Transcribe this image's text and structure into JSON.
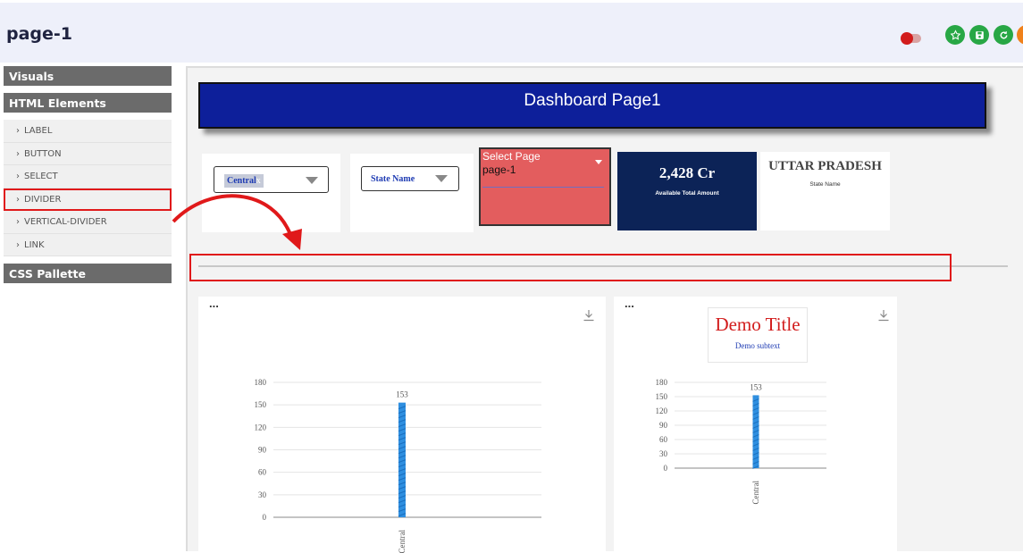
{
  "header": {
    "title": "page-1",
    "buttons": [
      {
        "name": "star",
        "color": "#28a745"
      },
      {
        "name": "save",
        "color": "#28a745"
      },
      {
        "name": "refresh",
        "color": "#28a745"
      },
      {
        "name": "extra",
        "color": "#f0811a"
      }
    ]
  },
  "sidebar": {
    "visuals": "Visuals",
    "html_elements": "HTML Elements",
    "items": [
      {
        "label": "LABEL"
      },
      {
        "label": "BUTTON"
      },
      {
        "label": "SELECT"
      },
      {
        "label": "DIVIDER",
        "highlighted": true
      },
      {
        "label": "VERTICAL-DIVIDER"
      },
      {
        "label": "LINK"
      }
    ],
    "css_palette": "CSS Pallette"
  },
  "dashboard": {
    "banner": "Dashboard Page1",
    "filter_central": {
      "chip": "Central",
      "chip_remove": "x"
    },
    "filter_state": {
      "placeholder": "State Name"
    },
    "page_select": {
      "label": "Select Page",
      "value": "page-1"
    },
    "kpi": {
      "value": "2,428 Cr",
      "label": "Available Total Amount"
    },
    "state_card": {
      "value": "UTTAR PRADESH",
      "label": "State Name"
    },
    "chart_menu": "...",
    "demo": {
      "title": "Demo Title",
      "subtitle": "Demo subtext"
    }
  },
  "chart_data": [
    {
      "type": "bar",
      "categories": [
        "Central"
      ],
      "values": [
        153
      ],
      "data_labels": [
        "153"
      ],
      "ylim": [
        0,
        180
      ],
      "yticks": [
        0,
        30,
        60,
        90,
        120,
        150,
        180
      ],
      "title": "",
      "xlabel": "",
      "ylabel": "",
      "bar_color": "#2f8fe0"
    },
    {
      "type": "bar",
      "categories": [
        "Central"
      ],
      "values": [
        153
      ],
      "data_labels": [
        "153"
      ],
      "ylim": [
        0,
        180
      ],
      "yticks": [
        0,
        30,
        60,
        90,
        120,
        150,
        180
      ],
      "title": "Demo Title",
      "subtitle": "Demo subtext",
      "xlabel": "",
      "ylabel": "",
      "bar_color": "#2f8fe0"
    }
  ]
}
